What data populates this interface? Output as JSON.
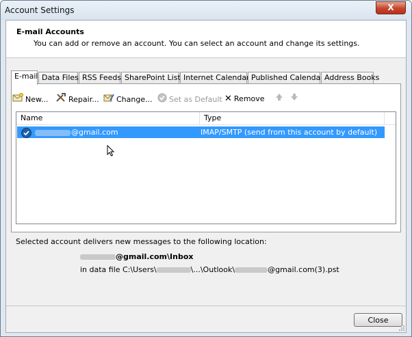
{
  "window": {
    "title": "Account Settings",
    "close_glyph": "X"
  },
  "header": {
    "title": "E-mail Accounts",
    "subtitle": "You can add or remove an account. You can select an account and change its settings."
  },
  "tabs": [
    {
      "label": "E-mail",
      "active": true
    },
    {
      "label": "Data Files",
      "active": false
    },
    {
      "label": "RSS Feeds",
      "active": false
    },
    {
      "label": "SharePoint Lists",
      "active": false
    },
    {
      "label": "Internet Calendars",
      "active": false
    },
    {
      "label": "Published Calendars",
      "active": false
    },
    {
      "label": "Address Books",
      "active": false
    }
  ],
  "toolbar": {
    "new_label": "New...",
    "repair_label": "Repair...",
    "change_label": "Change...",
    "set_default_label": "Set as Default",
    "remove_label": "Remove",
    "remove_glyph": "✕",
    "icons": [
      "new-mail-icon",
      "repair-tools-icon",
      "change-account-icon",
      "set-default-icon",
      "remove-icon",
      "arrow-up-icon",
      "arrow-down-icon"
    ]
  },
  "accounts_table": {
    "columns": [
      "Name",
      "Type"
    ],
    "rows": [
      {
        "name_suffix": "@gmail.com",
        "type": "IMAP/SMTP (send from this account by default)",
        "selected": true
      }
    ]
  },
  "delivery": {
    "label": "Selected account delivers new messages to the following location:",
    "inbox_suffix": "@gmail.com\\Inbox",
    "datafile_prefix": "in data file C:\\Users\\",
    "datafile_middle": "\\...\\Outlook\\",
    "datafile_suffix": "@gmail.com(3).pst"
  },
  "footer": {
    "close_label": "Close"
  },
  "colors": {
    "selection": "#3399ff",
    "window_frame": "#dfe8f1",
    "close_button": "#c5442c"
  }
}
